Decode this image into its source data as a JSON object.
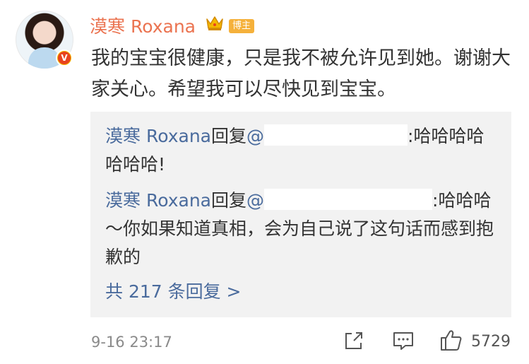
{
  "post": {
    "username": "漠寒 Roxana",
    "badge": "博主",
    "verified_mark": "V",
    "text": "我的宝宝很健康，只是我不被允许见到她。谢谢大家关心。希望我可以尽快见到宝宝。"
  },
  "replies": [
    {
      "nick": "漠寒 Roxana",
      "verb": "回复",
      "at": "@",
      "text": ":哈哈哈哈哈哈哈!"
    },
    {
      "nick": "漠寒 Roxana",
      "verb": "回复",
      "at": "@",
      "text": ":哈哈哈～你如果知道真相，会为自己说了这句话而感到抱歉的"
    }
  ],
  "reply_count_label": "共 217 条回复 >",
  "footer": {
    "timestamp": "9-16 23:17",
    "like_count": "5729"
  },
  "icons": {
    "avatar": "user-avatar",
    "verified": "verified-v-icon",
    "crown": "crown-icon",
    "share": "share-icon",
    "comment": "comment-icon",
    "like": "thumbs-up-icon"
  },
  "colors": {
    "username": "#eb7350",
    "link": "#4a6b9d",
    "reply_bg": "#f2f2f2",
    "badge_bg": "#f5b13b"
  }
}
